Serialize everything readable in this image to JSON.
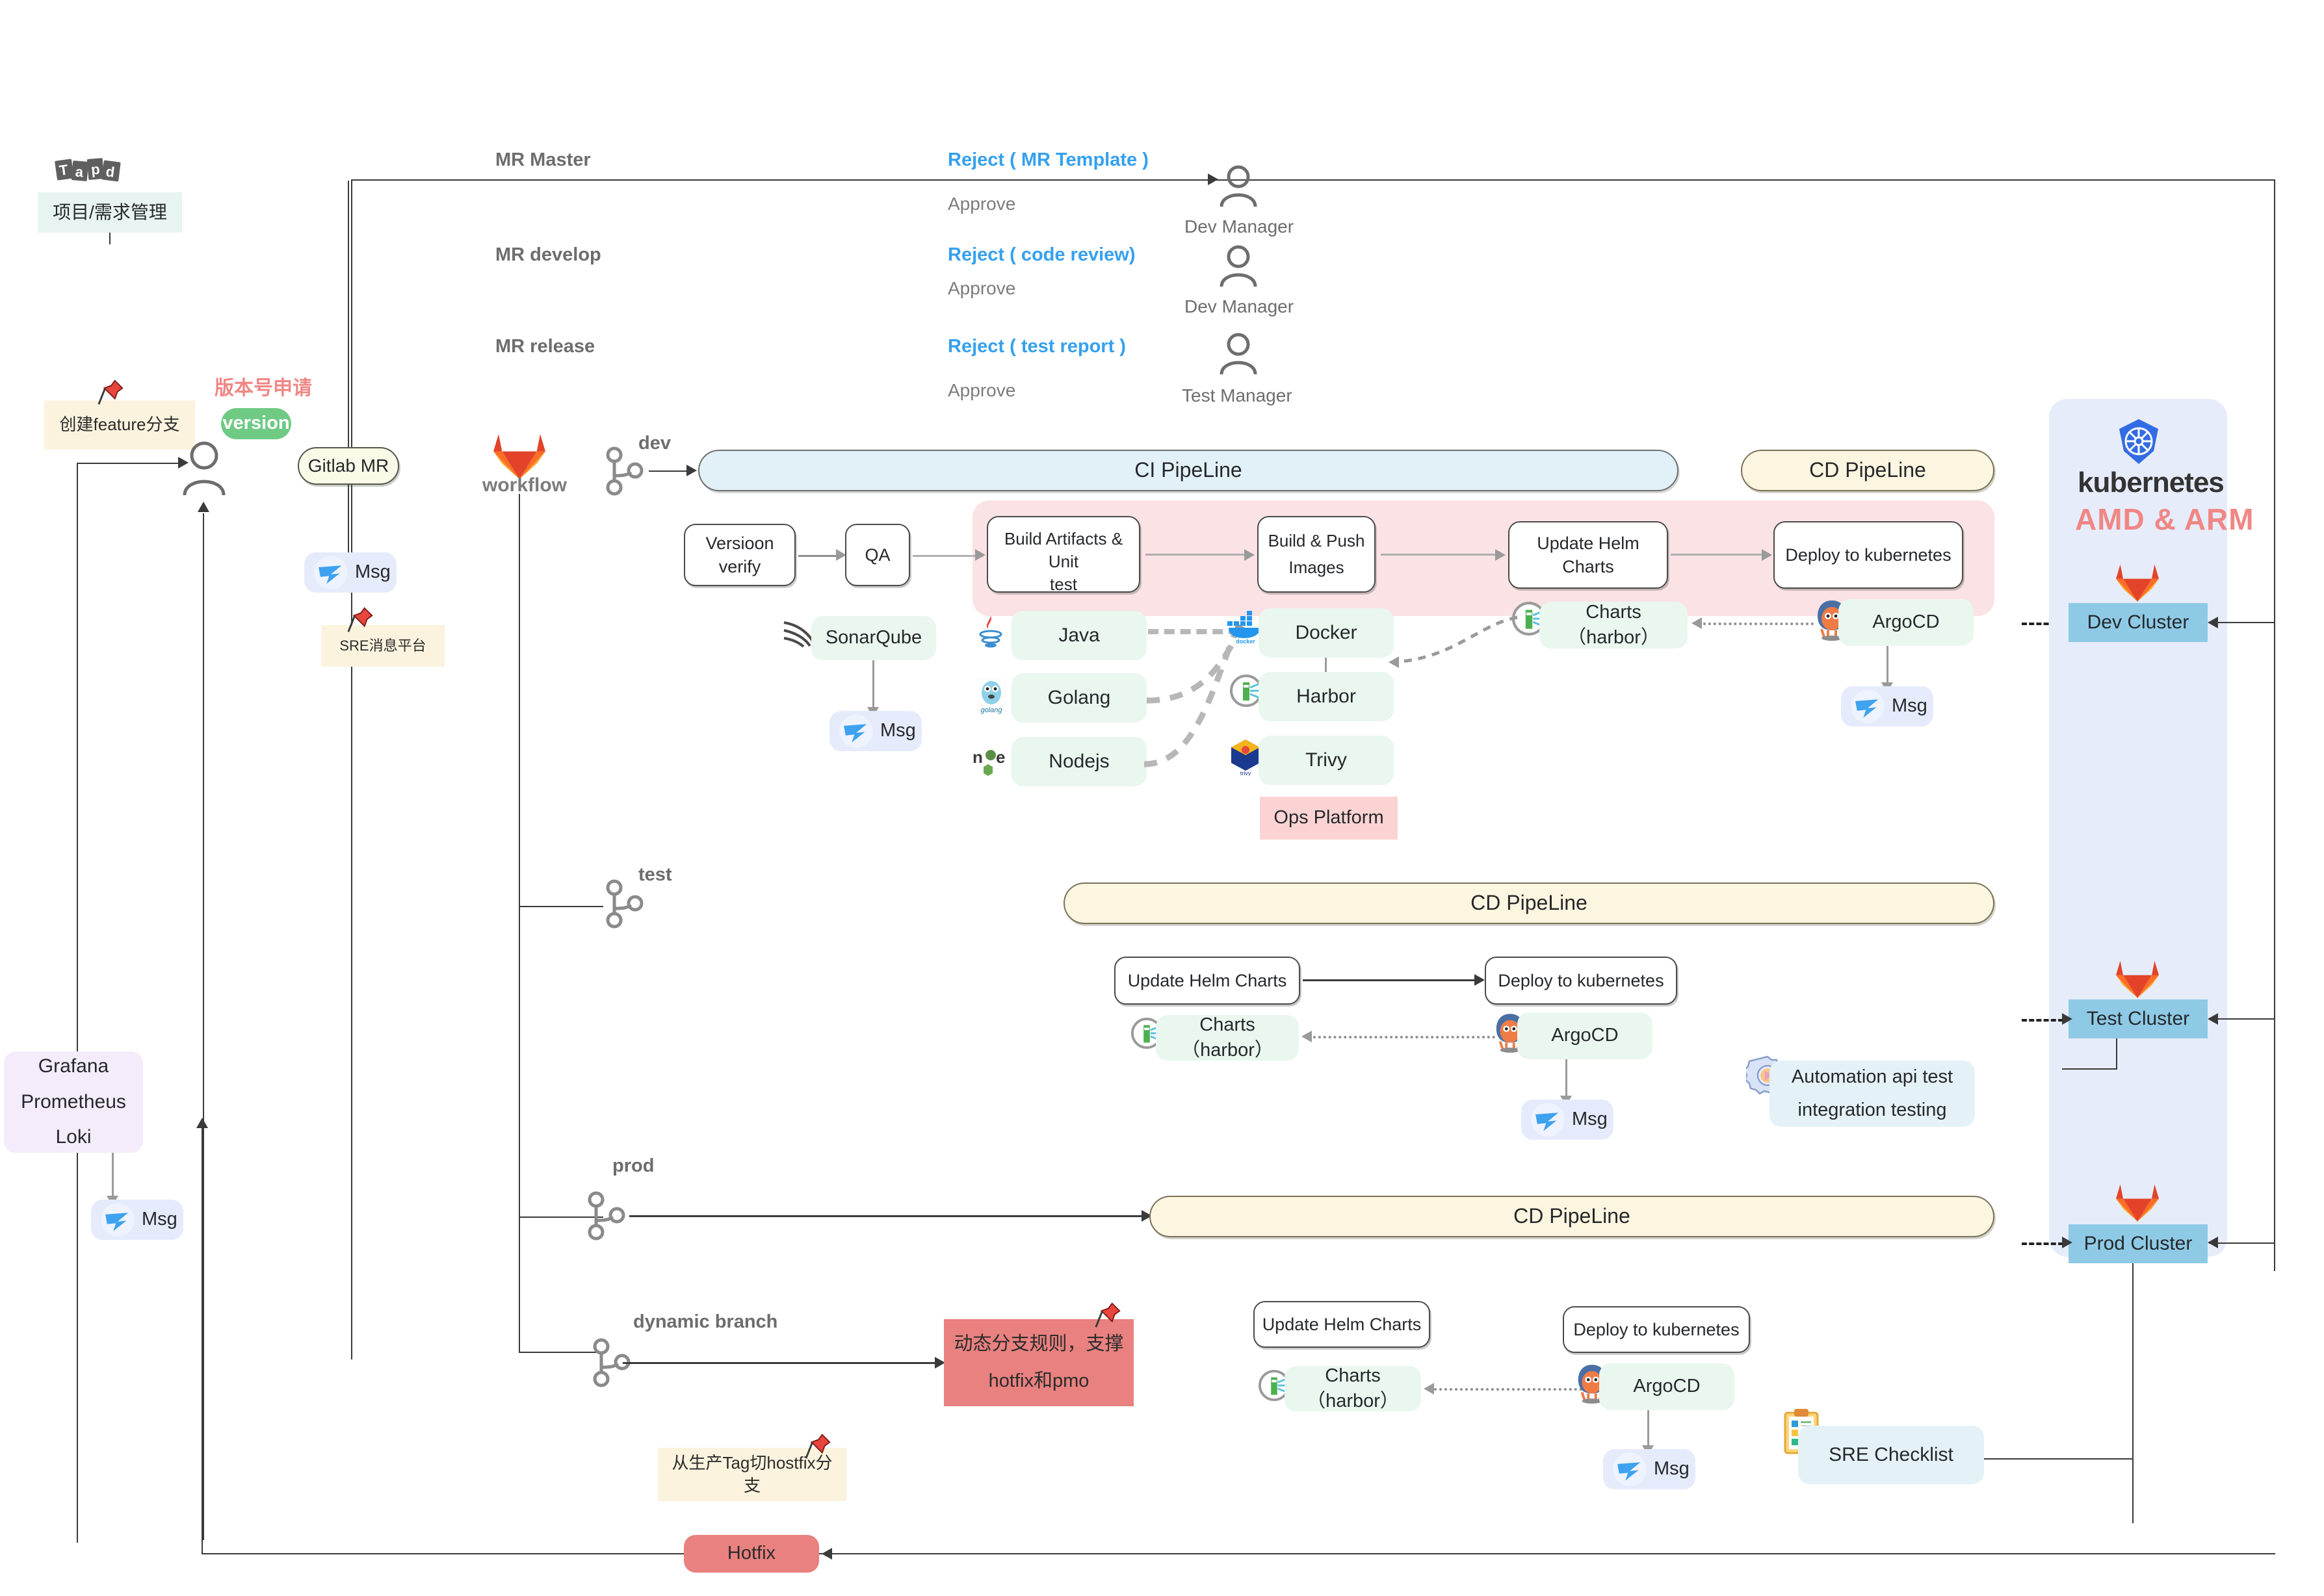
{
  "title": "DevOps CI/CD Pipeline Flow Diagram",
  "left_column": {
    "tapd_logo": "Tapd",
    "tapd_box": "项目/需求管理",
    "create_feature_note": "创建feature分支",
    "version_request_label": "版本号申请",
    "version_badge": "version",
    "gitlab_mr": "Gitlab MR",
    "msg_label": "Msg",
    "sre_msg_note": "SRE消息平台",
    "workflow_label": "workflow",
    "observability": "Grafana\nPrometheus\nLoki",
    "observability_lines": [
      "Grafana",
      "Prometheus",
      "Loki"
    ],
    "observability_msg": "Msg"
  },
  "mr_lanes": [
    {
      "branch": "MR  Master",
      "reject": "Reject ( MR Template )",
      "approve": "Approve",
      "role": "Dev Manager"
    },
    {
      "branch": "MR develop",
      "reject": "Reject ( code  review)",
      "approve": "Approve",
      "role": "Dev Manager"
    },
    {
      "branch": "MR release",
      "reject": "Reject (  test report )",
      "approve": "Approve",
      "role": "Test Manager"
    }
  ],
  "branch_labels": {
    "dev": "dev",
    "test": "test",
    "prod": "prod",
    "dynamic": "dynamic branch"
  },
  "dev_stage": {
    "ci_pipeline": "CI PipeLine",
    "cd_pipeline": "CD PipeLine",
    "pre_steps": [
      "Versioon verify",
      "QA"
    ],
    "ci_steps": [
      "Build Artifacts & Unit\ntest",
      "Build & Push\nImages",
      "Update Helm Charts",
      "Deploy to kubernetes"
    ],
    "ci_step_1_l1": "Build Artifacts & Unit",
    "ci_step_1_l2": "test",
    "ci_step_2_l1": "Build & Push",
    "ci_step_2_l2": "Images",
    "ci_step_3": "Update Helm Charts",
    "ci_step_4": "Deploy to kubernetes",
    "sonarqube": "SonarQube",
    "sonar_msg": "Msg",
    "languages": [
      "Java",
      "Golang",
      "Nodejs"
    ],
    "registry": [
      "Docker",
      "Harbor",
      "Trivy"
    ],
    "ops_platform": "Ops Platform",
    "charts_harbor": "Charts（harbor）",
    "argocd": "ArgoCD",
    "argocd_msg": "Msg"
  },
  "test_stage": {
    "cd_pipeline": "CD PipeLine",
    "update_helm": "Update Helm Charts",
    "deploy_k8s": "Deploy to kubernetes",
    "charts_harbor": "Charts（harbor）",
    "argocd": "ArgoCD",
    "argocd_msg": "Msg",
    "automation_l1": "Automation api test",
    "automation_l2": "integration testing"
  },
  "prod_stage": {
    "cd_pipeline": "CD PipeLine"
  },
  "dynamic_stage": {
    "rule_note_l1": "动态分支规则，支撑",
    "rule_note_l2": "hotfix和pmo",
    "update_helm": "Update Helm Charts",
    "deploy_k8s": "Deploy to kubernetes",
    "charts_harbor": "Charts（harbor）",
    "argocd": "ArgoCD",
    "argocd_msg": "Msg",
    "hotfix_note": "从生产Tag切hostfix分支",
    "hotfix": "Hotfix",
    "sre_checklist": "SRE Checklist"
  },
  "k8s_panel": {
    "title": "kubernetes",
    "arch": "AMD & ARM",
    "clusters": [
      "Dev Cluster",
      "Test Cluster",
      "Prod Cluster"
    ]
  },
  "colors": {
    "ci_pipeline_bg": "#e2f1f8",
    "cd_pipeline_bg": "#fcf5df",
    "ci_band_bg": "#fbe2e4",
    "green_node_bg": "#eaf6ea",
    "k8s_panel_bg": "#e7ecfa",
    "cluster_bg": "#8ecae6",
    "reject_text": "#35a0ee",
    "accent_red": "#f08784",
    "version_green": "#6fca84",
    "note_cream": "#fbf3de",
    "ops_pink": "#fbd3d3",
    "hotfix_red": "#e8817f",
    "observability_lav": "#f4ecfb",
    "msg_bg": "#e6ebfc"
  }
}
